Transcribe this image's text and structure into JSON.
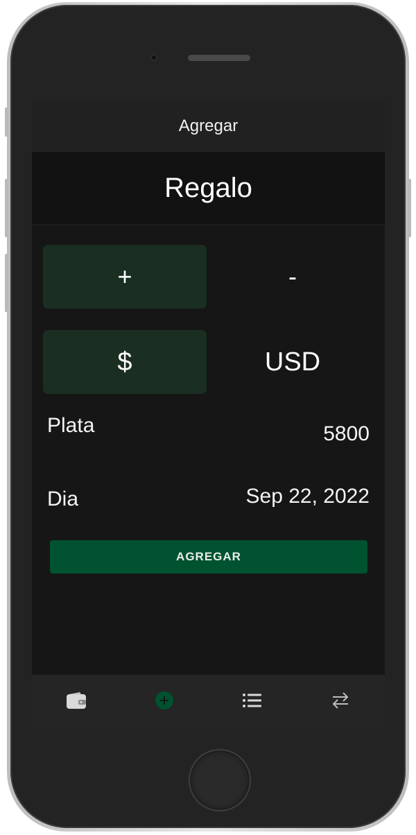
{
  "appbar": {
    "title": "Agregar"
  },
  "category": {
    "name": "Regalo"
  },
  "sign_toggle": {
    "plus_label": "+",
    "minus_label": "-",
    "selected": "plus"
  },
  "currency_toggle": {
    "peso_label": "$",
    "usd_label": "USD",
    "selected": "peso"
  },
  "amount": {
    "label": "Plata",
    "value": "5800"
  },
  "date": {
    "label": "Dia",
    "value": "Sep 22, 2022"
  },
  "submit": {
    "label": "AGREGAR"
  },
  "bottom_nav": {
    "items": [
      {
        "icon": "wallet-icon",
        "active": false
      },
      {
        "icon": "add-circle-icon",
        "active": true
      },
      {
        "icon": "list-icon",
        "active": false
      },
      {
        "icon": "transfer-icon",
        "active": false
      }
    ]
  },
  "colors": {
    "accent": "#005230",
    "active_toggle": "#1a2e22",
    "background": "#161616"
  }
}
